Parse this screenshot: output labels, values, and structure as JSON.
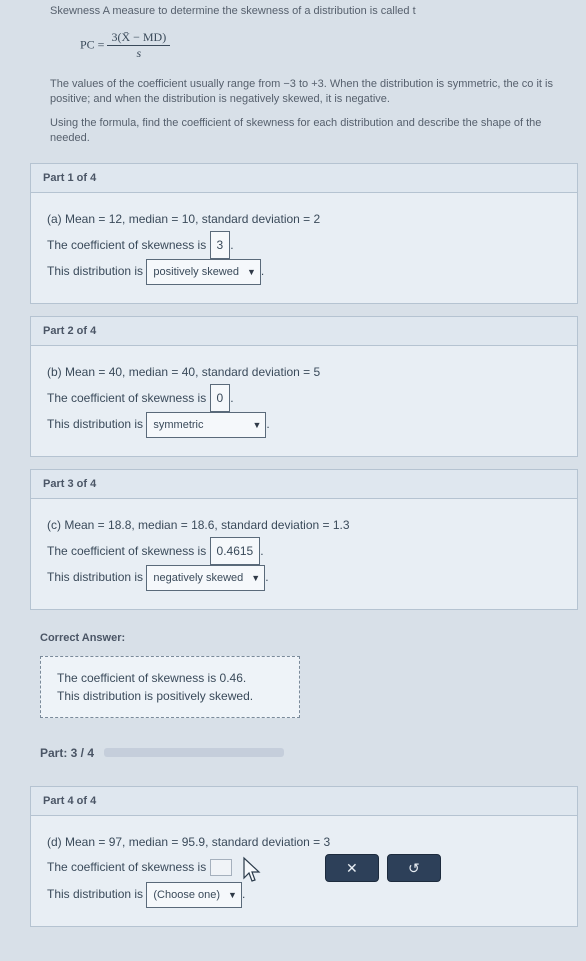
{
  "intro": {
    "heading_fragment": "Skewness A measure to determine the skewness of a distribution is called t",
    "formula_label": "PC =",
    "formula_numerator": "3(X̄ − MD)",
    "formula_denominator": "s",
    "paragraph1": "The values of the coefficient usually range from −3 to +3. When the distribution is symmetric, the co it is positive; and when the distribution is negatively skewed, it is negative.",
    "paragraph2": "Using the formula, find the coefficient of skewness for each distribution and describe the shape of the needed."
  },
  "parts": {
    "p1": {
      "header": "Part 1 of 4",
      "stat_line": "(a) Mean = 12, median = 10, standard deviation = 2",
      "coef_label": "The coefficient of skewness is",
      "coef_value": "3",
      "dist_label": "This distribution is",
      "dist_value": "positively skewed"
    },
    "p2": {
      "header": "Part 2 of 4",
      "stat_line": "(b) Mean = 40, median = 40, standard deviation = 5",
      "coef_label": "The coefficient of skewness is",
      "coef_value": "0",
      "dist_label": "This distribution is",
      "dist_value": "symmetric"
    },
    "p3": {
      "header": "Part 3 of 4",
      "stat_line": "(c) Mean = 18.8, median = 18.6, standard deviation = 1.3",
      "coef_label": "The coefficient of skewness is",
      "coef_value": "0.4615",
      "dist_label": "This distribution is",
      "dist_value": "negatively skewed"
    },
    "correct": {
      "header": "Correct Answer:",
      "line1": "The coefficient of skewness is 0.46.",
      "line2": "This distribution is positively skewed."
    },
    "progress": {
      "label": "Part: 3 / 4"
    },
    "p4": {
      "header": "Part 4 of 4",
      "stat_line": "(d) Mean = 97, median = 95.9, standard deviation = 3",
      "coef_label": "The coefficient of skewness is",
      "dist_label": "This distribution is",
      "dist_value": "(Choose one)",
      "btn_close": "✕",
      "btn_reset": "↺"
    }
  }
}
